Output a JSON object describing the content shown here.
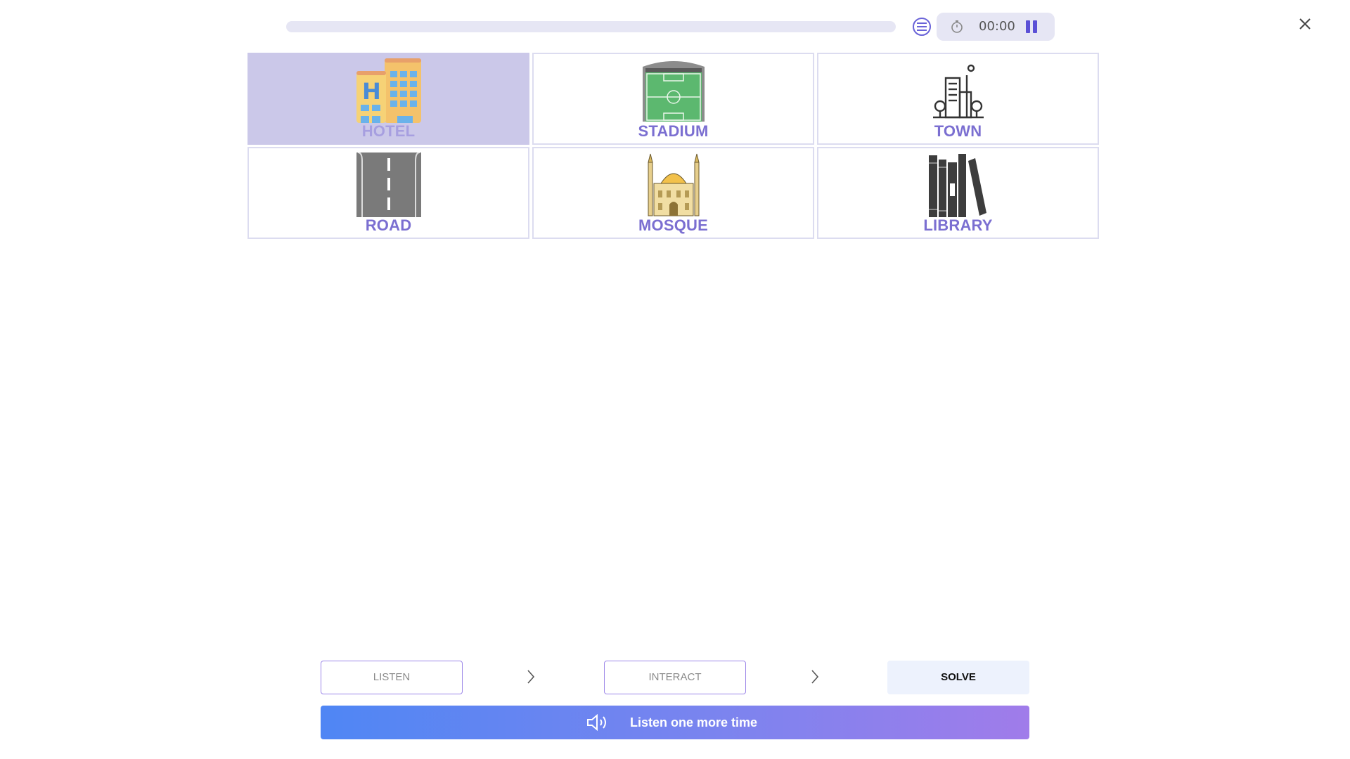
{
  "header": {
    "progress": 0,
    "timer": "00:00",
    "icons": {
      "list": "list-icon",
      "timer": "stopwatch-icon",
      "pause": "pause-icon",
      "close": "close-icon"
    }
  },
  "options": [
    {
      "label": "HOTEL",
      "icon": "hotel-icon",
      "selected": true
    },
    {
      "label": "STADIUM",
      "icon": "stadium-icon",
      "selected": false
    },
    {
      "label": "TOWN",
      "icon": "town-icon",
      "selected": false
    },
    {
      "label": "ROAD",
      "icon": "road-icon",
      "selected": false
    },
    {
      "label": "MOSQUE",
      "icon": "mosque-icon",
      "selected": false
    },
    {
      "label": "LIBRARY",
      "icon": "library-icon",
      "selected": false
    }
  ],
  "steps": {
    "listen": "LISTEN",
    "interact": "INTERACT",
    "solve": "SOLVE"
  },
  "listen_again": {
    "label": "Listen one more time",
    "icon": "speaker-icon"
  },
  "colors": {
    "accent": "#7b6fd1",
    "selected_bg": "#cbc8e9",
    "gradient_start": "#4f86f4",
    "gradient_end": "#a07cea"
  }
}
